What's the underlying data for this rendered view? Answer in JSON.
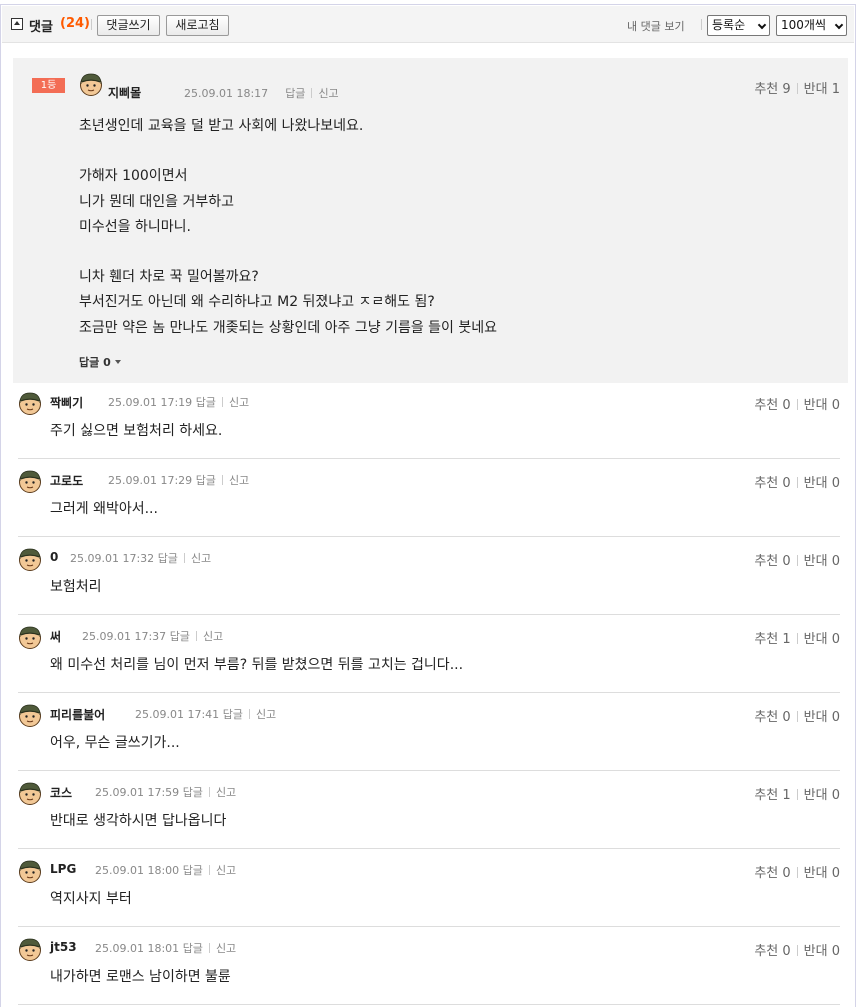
{
  "header": {
    "title": "댓글",
    "count": "(24)",
    "write_label": "댓글쓰기",
    "refresh_label": "새로고침",
    "my_comments_label": "내 댓글 보기",
    "sort_select": "등록순",
    "per_page_select": "100개씩"
  },
  "best_comment": {
    "badge": "1등",
    "nickname": "지삐몰",
    "time": "25.09.01 18:17",
    "reply_label": "답글",
    "report_label": "신고",
    "upvote": "추천 9",
    "downvote": "반대 1",
    "lines": [
      "초년생인데 교육을 덜 받고 사회에 나왔나보네요.",
      "",
      "가해자 100이면서",
      "니가 뭔데 대인을 거부하고",
      "미수선을 하니마니.",
      "",
      "니차 휀더 차로 꾹 밀어볼까요?",
      "부서진거도 아닌데 왜 수리하냐고 M2 뒤졌냐고 ㅈㄹ해도 됨?",
      "조금만 약은 놈 만나도 개좆되는 상황인데 아주 그냥 기름을 들이 붓네요"
    ],
    "reply_count_label": "답글 0"
  },
  "comments": [
    {
      "nickname": "짝삐기",
      "time": "25.09.01 17:19",
      "reply": "답글",
      "report": "신고",
      "upvote": "추천 0",
      "downvote": "반대 0",
      "text": "주기 싫으면 보험처리 하세요."
    },
    {
      "nickname": "고로도",
      "time": "25.09.01 17:29",
      "reply": "답글",
      "report": "신고",
      "upvote": "추천 0",
      "downvote": "반대 0",
      "text": "그러게 왜박아서..."
    },
    {
      "nickname": "0",
      "time": "25.09.01 17:32",
      "reply": "답글",
      "report": "신고",
      "upvote": "추천 0",
      "downvote": "반대 0",
      "text": "보험처리"
    },
    {
      "nickname": "써",
      "time": "25.09.01 17:37",
      "reply": "답글",
      "report": "신고",
      "upvote": "추천 1",
      "downvote": "반대 0",
      "text": "왜 미수선 처리를 님이 먼저 부름? 뒤를 받쳤으면 뒤를 고치는 겁니다..."
    },
    {
      "nickname": "피리를불어",
      "time": "25.09.01 17:41",
      "reply": "답글",
      "report": "신고",
      "upvote": "추천 0",
      "downvote": "반대 0",
      "text": "어우, 무슨 글쓰기가..."
    },
    {
      "nickname": "코스",
      "time": "25.09.01 17:59",
      "reply": "답글",
      "report": "신고",
      "upvote": "추천 1",
      "downvote": "반대 0",
      "text": "반대로 생각하시면 답나옵니다"
    },
    {
      "nickname": "LPG",
      "time": "25.09.01 18:00",
      "reply": "답글",
      "report": "신고",
      "upvote": "추천 0",
      "downvote": "반대 0",
      "text": "역지사지 부터"
    },
    {
      "nickname": "jt53",
      "time": "25.09.01 18:01",
      "reply": "답글",
      "report": "신고",
      "upvote": "추천 0",
      "downvote": "반대 0",
      "text": "내가하면 로맨스 남이하면 불륜"
    }
  ],
  "avatar_icon": "soldier-avatar-icon",
  "colors": {
    "count": "#ff5a00",
    "badge": "#f36d55",
    "best_bg": "#f2f2f2",
    "header_bg": "#f4f4f4"
  }
}
